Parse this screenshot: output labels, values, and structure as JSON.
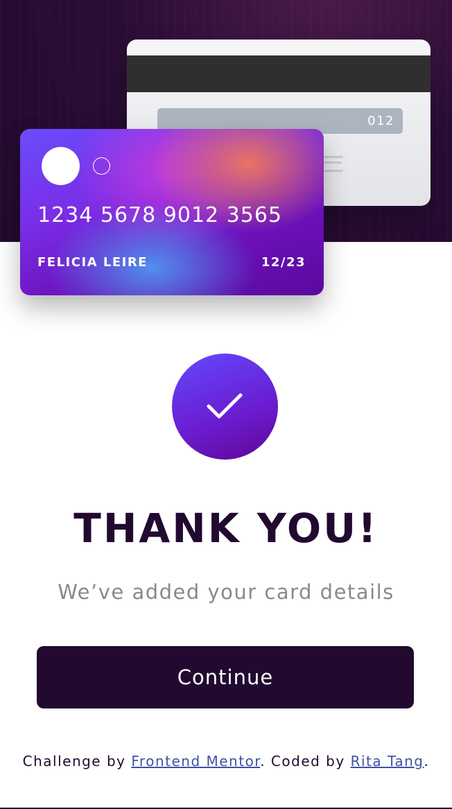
{
  "card_back": {
    "cvc": "012"
  },
  "card_front": {
    "number": "1234 5678 9012 3565",
    "holder": "FELICIA LEIRE",
    "expiry": "12/23"
  },
  "success": {
    "icon": "check-icon",
    "title": "THANK YOU!",
    "message": "We’ve added your card details",
    "continue_label": "Continue"
  },
  "footer": {
    "prefix": "Challenge by ",
    "link1": "Frontend Mentor",
    "middle": ". Coded by ",
    "link2": "Rita Tang",
    "suffix": "."
  },
  "colors": {
    "dark": "#21092f",
    "muted": "#8e8593",
    "link": "#3e52a3",
    "accent_start": "#6448fe",
    "accent_end": "#600594"
  }
}
